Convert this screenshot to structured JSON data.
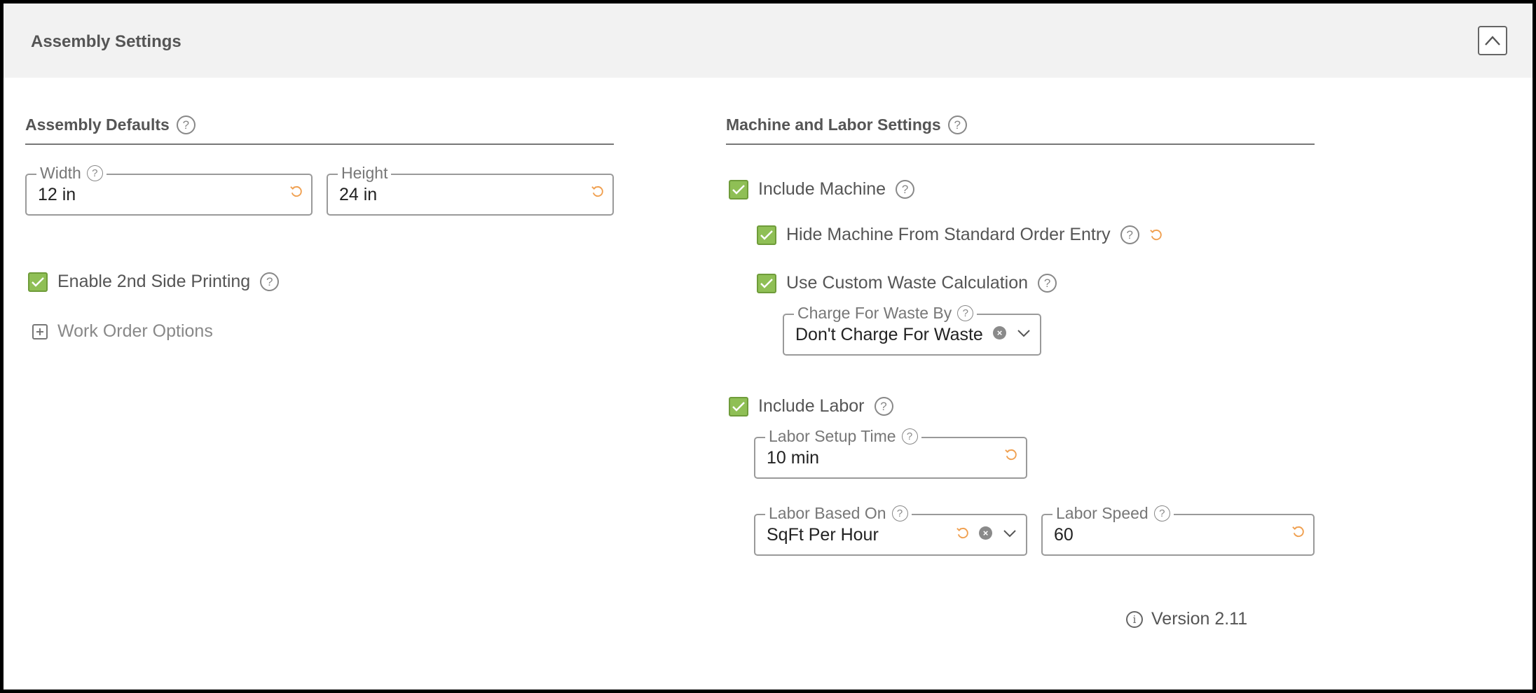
{
  "header": {
    "title": "Assembly Settings",
    "collapse_icon": "chevron-up-icon"
  },
  "assembly_defaults": {
    "title": "Assembly Defaults",
    "width": {
      "label": "Width",
      "value": "12 in"
    },
    "height": {
      "label": "Height",
      "value": "24 in"
    },
    "enable_2nd_side": {
      "label": "Enable 2nd Side Printing",
      "checked": true
    },
    "work_order_options": {
      "label": "Work Order Options"
    }
  },
  "machine_labor": {
    "title": "Machine and Labor Settings",
    "include_machine": {
      "label": "Include Machine",
      "checked": true
    },
    "hide_machine": {
      "label": "Hide Machine From Standard Order Entry",
      "checked": true
    },
    "custom_waste": {
      "label": "Use Custom Waste Calculation",
      "checked": true
    },
    "charge_for_waste": {
      "label": "Charge For Waste By",
      "value": "Don't Charge For Waste"
    },
    "include_labor": {
      "label": "Include Labor",
      "checked": true
    },
    "labor_setup_time": {
      "label": "Labor Setup Time",
      "value": "10 min"
    },
    "labor_based_on": {
      "label": "Labor Based On",
      "value": "SqFt Per Hour"
    },
    "labor_speed": {
      "label": "Labor Speed",
      "value": "60"
    }
  },
  "footer": {
    "version": "Version 2.11"
  },
  "colors": {
    "accent_green": "#8fbf55",
    "reset_orange": "#f0a050",
    "header_bg": "#f2f2f2"
  }
}
